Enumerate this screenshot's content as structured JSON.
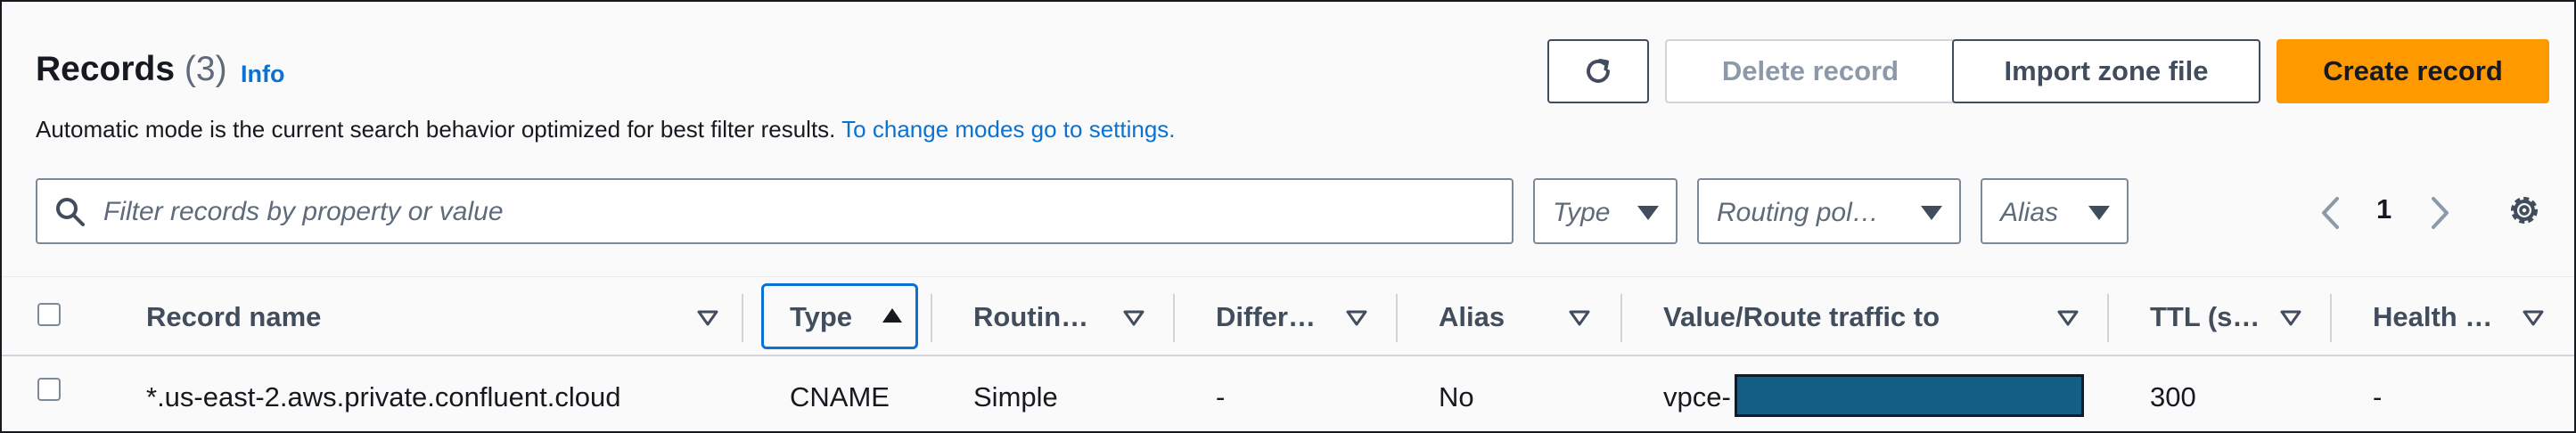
{
  "header": {
    "title": "Records",
    "count": "(3)",
    "info_link": "Info",
    "description": "Automatic mode is the current search behavior optimized for best filter results.",
    "settings_link": "To change modes go to settings."
  },
  "actions": {
    "refresh_icon": "refresh-icon",
    "delete": "Delete record",
    "import": "Import zone file",
    "create": "Create record"
  },
  "filters": {
    "search_placeholder": "Filter records by property or value",
    "type": "Type",
    "routing": "Routing pol…",
    "alias": "Alias"
  },
  "pagination": {
    "page": "1"
  },
  "table": {
    "columns": [
      "Record name",
      "Type",
      "Routin…",
      "Differ…",
      "Alias",
      "Value/Route traffic to",
      "TTL (s…",
      "Health …"
    ],
    "rows": [
      {
        "record_name": "*.us-east-2.aws.private.confluent.cloud",
        "type": "CNAME",
        "routing": "Simple",
        "differentiator": "-",
        "alias": "No",
        "value": "vpce-",
        "ttl": "300",
        "health": "-"
      }
    ]
  },
  "colors": {
    "accent": "#0972d3",
    "primary_button": "#ff9900",
    "redaction": "#135e84"
  }
}
